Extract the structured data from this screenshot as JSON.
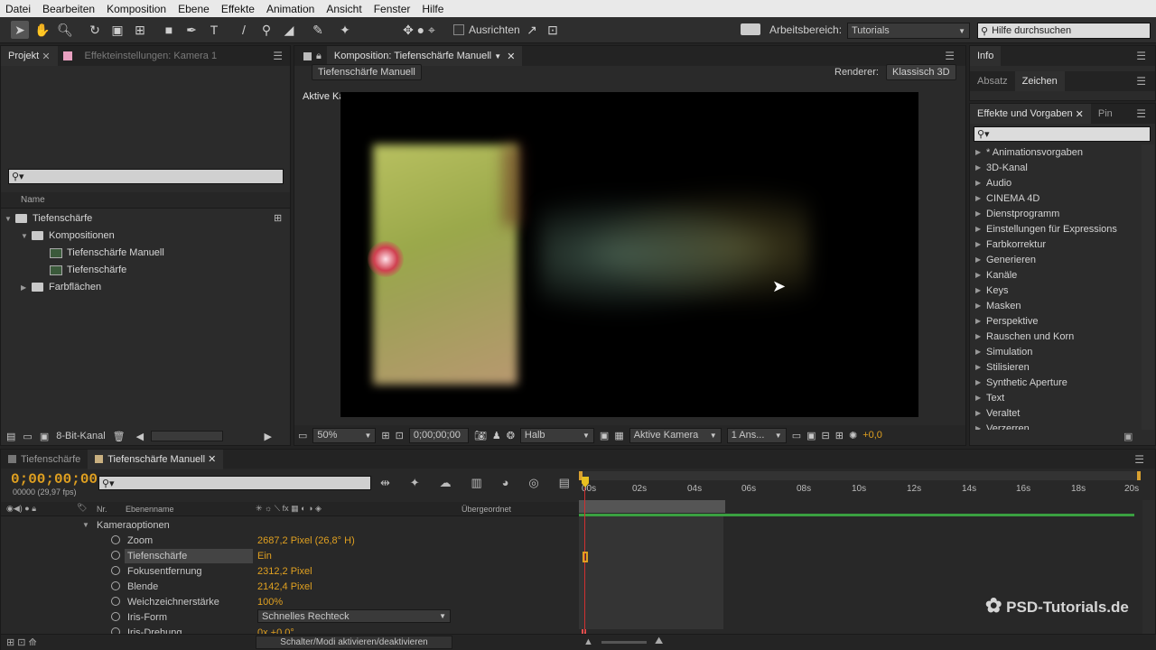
{
  "menubar": {
    "items": [
      "Datei",
      "Bearbeiten",
      "Komposition",
      "Ebene",
      "Effekte",
      "Animation",
      "Ansicht",
      "Fenster",
      "Hilfe"
    ]
  },
  "toolbar": {
    "ausrichten": "Ausrichten",
    "arbeitsbereich_label": "Arbeitsbereich:",
    "arbeitsbereich_value": "Tutorials",
    "help_placeholder": "Hilfe durchsuchen"
  },
  "project": {
    "tab": "Projekt",
    "tab2": "Effekteinstellungen: Kamera 1",
    "col_name": "Name",
    "tree": [
      "Tiefenschärfe",
      "Kompositionen",
      "Tiefenschärfe Manuell",
      "Tiefenschärfe",
      "Farbflächen"
    ],
    "bitdepth": "8-Bit-Kanal"
  },
  "comp": {
    "tab": "Komposition: Tiefenschärfe Manuell",
    "subtab": "Tiefenschärfe Manuell",
    "renderer_label": "Renderer:",
    "renderer_value": "Klassisch 3D",
    "view_label": "Aktive Kamera",
    "zoom": "50%",
    "timecode": "0;00;00;00",
    "resolution": "Halb",
    "camera": "Aktive Kamera",
    "views": "1 Ans...",
    "exposure": "+0,0"
  },
  "info": {
    "tab": "Info",
    "absatz": "Absatz",
    "zeichen": "Zeichen"
  },
  "effects": {
    "tab": "Effekte und Vorgaben",
    "tab2": "Pin",
    "items": [
      "* Animationsvorgaben",
      "3D-Kanal",
      "Audio",
      "CINEMA 4D",
      "Dienstprogramm",
      "Einstellungen für Expressions",
      "Farbkorrektur",
      "Generieren",
      "Kanäle",
      "Keys",
      "Masken",
      "Perspektive",
      "Rauschen und Korn",
      "Simulation",
      "Stilisieren",
      "Synthetic Aperture",
      "Text",
      "Veraltet",
      "Verzerren"
    ]
  },
  "timeline": {
    "tab1": "Tiefenschärfe",
    "tab2": "Tiefenschärfe Manuell",
    "timecode": "0;00;00;00",
    "fps": "00000 (29,97 fps)",
    "col_nr": "Nr.",
    "col_name": "Ebenenname",
    "col_parent": "Übergeordnet",
    "section": "Kameraoptionen",
    "props": [
      {
        "name": "Zoom",
        "value": "2687,2 Pixel (26,8° H)"
      },
      {
        "name": "Tiefenschärfe",
        "value": "Ein"
      },
      {
        "name": "Fokusentfernung",
        "value": "2312,2 Pixel"
      },
      {
        "name": "Blende",
        "value": "2142,4 Pixel"
      },
      {
        "name": "Weichzeichnerstärke",
        "value": "100%"
      },
      {
        "name": "Iris-Form",
        "value": "Schnelles Rechteck"
      },
      {
        "name": "Iris-Drehung",
        "value": "0x +0,0°"
      }
    ],
    "ruler": [
      "00s",
      "02s",
      "04s",
      "06s",
      "08s",
      "10s",
      "12s",
      "14s",
      "16s",
      "18s",
      "20s"
    ],
    "toggle": "Schalter/Modi aktivieren/deaktivieren"
  },
  "watermark": "PSD-Tutorials.de"
}
